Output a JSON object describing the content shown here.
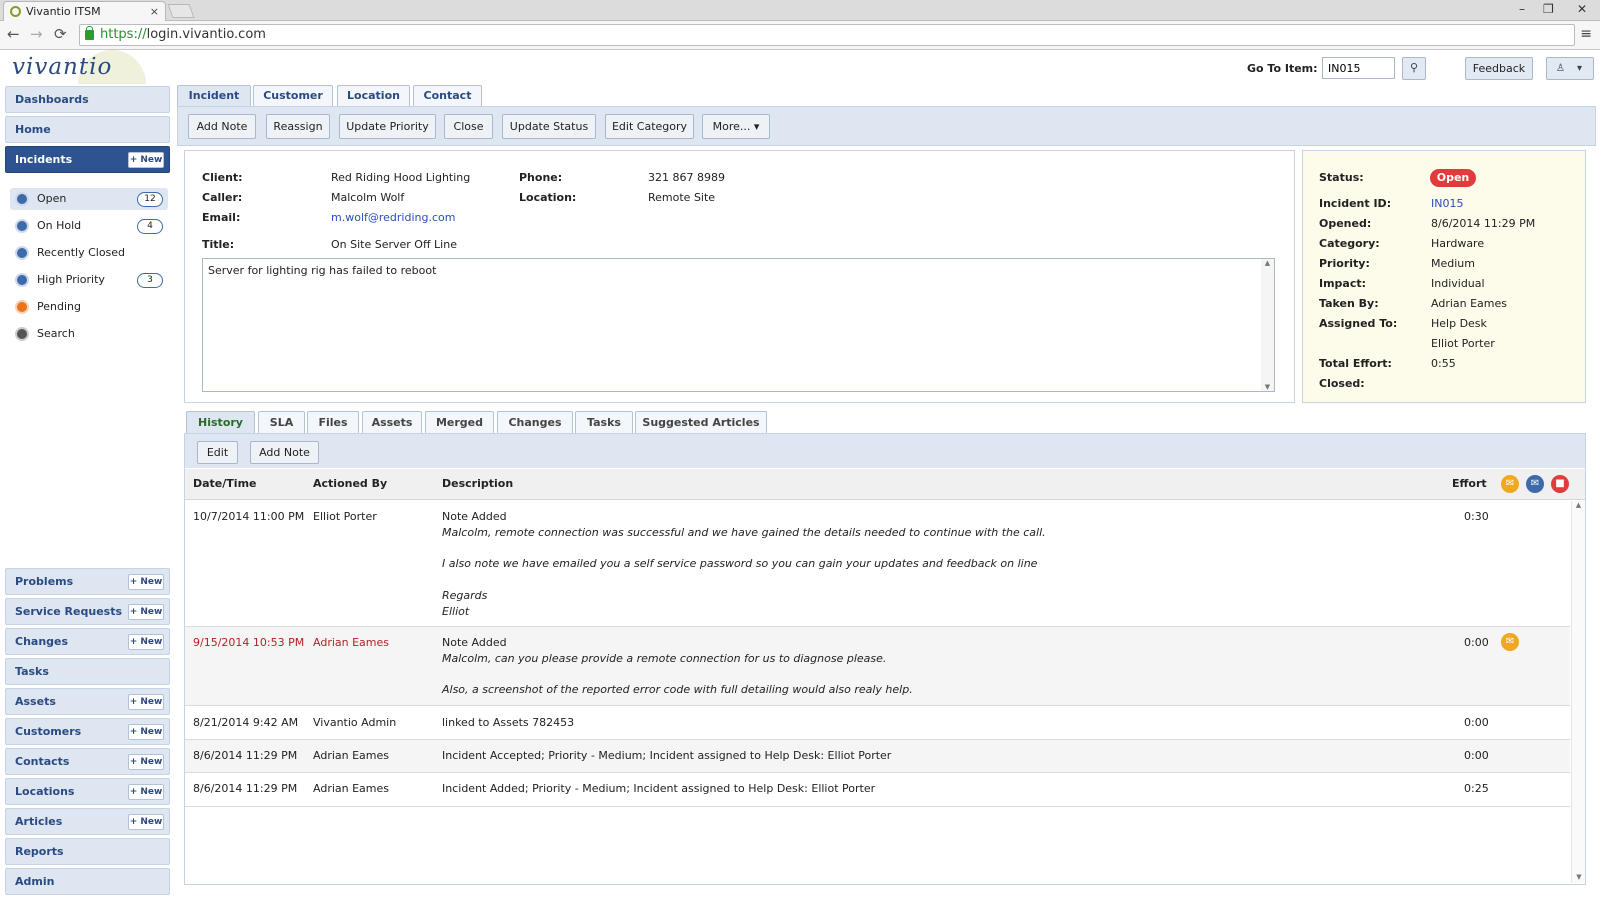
{
  "browser": {
    "tab_title": "Vivantio ITSM",
    "tab_close": "×",
    "url_scheme": "https://",
    "url_host": "login.vivantio.com",
    "back": "←",
    "forward": "→",
    "reload": "⟳",
    "menu": "≡",
    "minimize": "–",
    "restore": "❐",
    "close": "✕"
  },
  "header": {
    "logo": "vivantio",
    "goto_label": "Go To Item:",
    "goto_value": "IN015",
    "search_icon": "⚲",
    "feedback": "Feedback",
    "user_icon": "♙",
    "user_caret": "▾"
  },
  "sidebar": {
    "dashboards": "Dashboards",
    "home": "Home",
    "incidents": "Incidents",
    "new": "+ New",
    "incident_views": [
      {
        "label": "Open",
        "count": "12"
      },
      {
        "label": "On Hold",
        "count": "4"
      },
      {
        "label": "Recently Closed"
      },
      {
        "label": "High Priority",
        "count": "3"
      },
      {
        "label": "Pending"
      },
      {
        "label": "Search"
      }
    ],
    "modules": [
      {
        "label": "Problems",
        "new": "+ New"
      },
      {
        "label": "Service Requests",
        "new": "+ New"
      },
      {
        "label": "Changes",
        "new": "+ New"
      },
      {
        "label": "Tasks"
      },
      {
        "label": "Assets",
        "new": "+ New"
      },
      {
        "label": "Customers",
        "new": "+ New"
      },
      {
        "label": "Contacts",
        "new": "+ New"
      },
      {
        "label": "Locations",
        "new": "+ New"
      },
      {
        "label": "Articles",
        "new": "+ New"
      },
      {
        "label": "Reports"
      },
      {
        "label": "Admin"
      }
    ]
  },
  "tabs": [
    "Incident",
    "Customer",
    "Location",
    "Contact"
  ],
  "toolbar": [
    "Add Note",
    "Reassign",
    "Update Priority",
    "Close",
    "Update Status",
    "Edit Category",
    "More..."
  ],
  "details": {
    "client_label": "Client:",
    "client": "Red Riding Hood Lighting",
    "caller_label": "Caller:",
    "caller": "Malcolm Wolf",
    "email_label": "Email:",
    "email": "m.wolf@redriding.com",
    "phone_label": "Phone:",
    "phone": "321 867 8989",
    "location_label": "Location:",
    "location": "Remote Site",
    "title_label": "Title:",
    "title": "On Site Server Off Line",
    "description": "Server for lighting rig has failed to reboot"
  },
  "status": {
    "status_label": "Status:",
    "status": "Open",
    "id_label": "Incident ID:",
    "id": "IN015",
    "opened_label": "Opened:",
    "opened": "8/6/2014 11:29 PM",
    "category_label": "Category:",
    "category": "Hardware",
    "priority_label": "Priority:",
    "priority": "Medium",
    "impact_label": "Impact:",
    "impact": "Individual",
    "taken_label": "Taken By:",
    "taken": "Adrian Eames",
    "assigned_label": "Assigned To:",
    "assigned_group": "Help Desk",
    "assigned_person": "Elliot Porter",
    "effort_label": "Total Effort:",
    "effort": "0:55",
    "closed_label": "Closed:"
  },
  "history_tabs": [
    "History",
    "SLA",
    "Files",
    "Assets",
    "Merged",
    "Changes",
    "Tasks",
    "Suggested Articles"
  ],
  "history_buttons": [
    "Edit",
    "Add Note"
  ],
  "history_columns": {
    "date": "Date/Time",
    "by": "Actioned By",
    "desc": "Description",
    "effort": "Effort"
  },
  "history_icons": [
    "envelope-orange",
    "envelope-blue",
    "lock-red"
  ],
  "history": [
    {
      "date": "10/7/2014 11:00 PM",
      "by": "Elliot Porter",
      "title": "Note Added",
      "lines": [
        "Malcolm, remote connection was successful and we have gained the details needed to continue with the call.",
        "",
        "I also note we have emailed you a self service password so you can gain your updates and feedback on line",
        "",
        "Regards",
        "Elliot"
      ],
      "effort": "0:30"
    },
    {
      "date": "9/15/2014 10:53 PM",
      "by": "Adrian Eames",
      "title": "Note Added",
      "lines": [
        "Malcolm, can you please provide a remote connection for us to diagnose please.",
        "",
        "Also, a screenshot of the reported error code with full detailing would also realy help."
      ],
      "effort": "0:00"
    },
    {
      "date": "8/21/2014 9:42 AM",
      "by": "Vivantio Admin",
      "title": "linked to Assets 782453",
      "effort": "0:00"
    },
    {
      "date": "8/6/2014 11:29 PM",
      "by": "Adrian Eames",
      "title": "Incident Accepted; Priority - Medium; Incident assigned to Help Desk: Elliot Porter",
      "effort": "0:00"
    },
    {
      "date": "8/6/2014 11:29 PM",
      "by": "Adrian Eames",
      "title": "Incident Added; Priority - Medium; Incident assigned to Help Desk: Elliot Porter",
      "effort": "0:25"
    }
  ],
  "scroll_up": "▲",
  "scroll_down": "▼",
  "colors": {
    "brand": "#2b4a82",
    "active_nav": "#2d5390",
    "status_open": "#e13b3b",
    "status_panel": "#fdfbe9"
  }
}
